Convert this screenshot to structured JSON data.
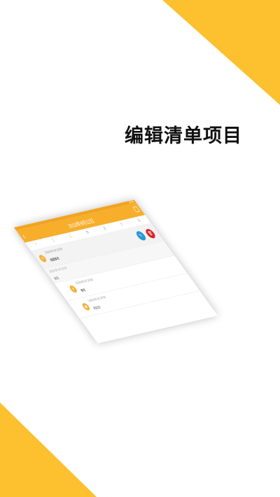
{
  "headline": "编辑清单项目",
  "colors": {
    "accent": "#f7ae2b",
    "edit": "#2a9ad6",
    "delete": "#d8262a"
  },
  "screen": {
    "status_text": "10:30",
    "title": "2018年9月12日",
    "back_icon": "chevron-left-icon",
    "calendar_icon": "calendar-icon",
    "weekdays": [
      "一",
      "二",
      "三",
      "四",
      "五",
      "六",
      "日"
    ],
    "items": [
      {
        "time": "2018-09-19 10:00",
        "name": "提醒事项",
        "icon": "list-icon",
        "swiped": true,
        "edit_icon": "pen-icon",
        "delete_icon": "trash-icon"
      }
    ],
    "group": {
      "time": "2018-09-19 10:00",
      "name": "会议"
    },
    "sub_items": [
      {
        "time": "2018-09-19 10:00",
        "name": "事项",
        "icon": "list-icon"
      },
      {
        "time": "2018-09-19 10:00",
        "name": "纪念日",
        "icon": "gift-icon"
      }
    ]
  }
}
